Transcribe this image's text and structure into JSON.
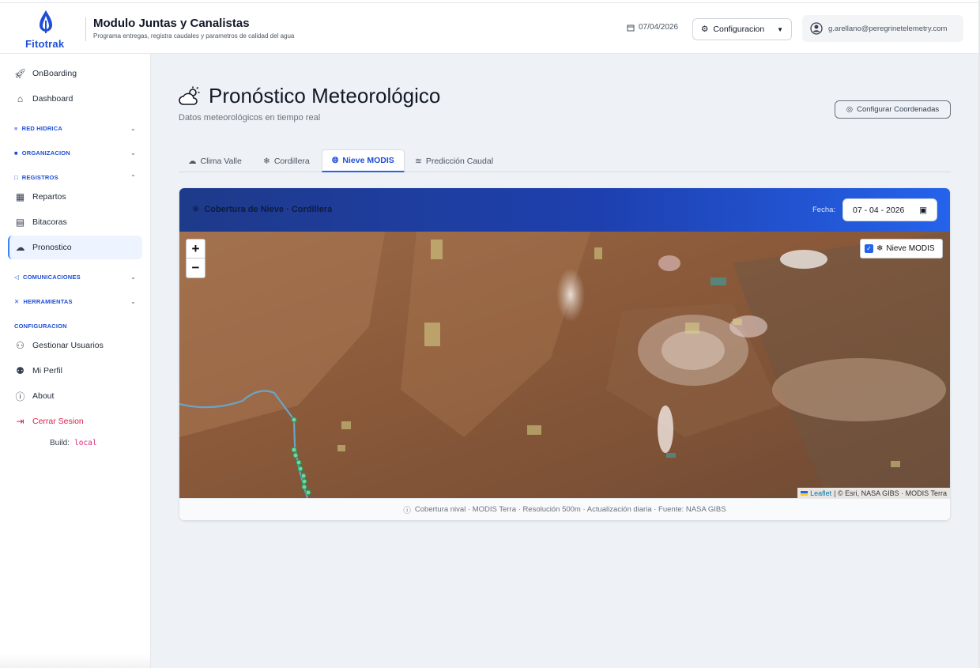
{
  "header": {
    "logo_text": "Fitotrak",
    "title": "Modulo Juntas y Canalistas",
    "subtitle": "Programa entregas, registra caudales y parametros de calidad del agua",
    "date": "07/04/2026",
    "config_label": "Configuracion",
    "user_email": "g.arellano@peregrinetelemetry.com"
  },
  "sidebar": {
    "onboarding": "OnBoarding",
    "dashboard": "Dashboard",
    "sec_red": "RED HIDRICA",
    "sec_org": "ORGANIZACION",
    "sec_reg": "REGISTROS",
    "repartos": "Repartos",
    "bitacoras": "Bitacoras",
    "pronostico": "Pronostico",
    "sec_com": "COMUNICACIONES",
    "sec_her": "HERRAMIENTAS",
    "sec_cfg": "CONFIGURACION",
    "usuarios": "Gestionar Usuarios",
    "perfil": "Mi Perfil",
    "about": "About",
    "logout": "Cerrar Sesion",
    "build_label": "Build:",
    "build_value": "local"
  },
  "page": {
    "title": "Pronóstico Meteorológico",
    "subtitle": "Datos meteorológicos en tiempo real",
    "coord_button": "Configurar Coordenadas"
  },
  "tabs": [
    "Clima Valle",
    "Cordillera",
    "Nieve MODIS",
    "Predicción Caudal"
  ],
  "active_tab": "Nieve MODIS",
  "card": {
    "title": "Cobertura de Nieve · Cordillera",
    "fecha_label": "Fecha:",
    "fecha_value": "07 - 04 - 2026",
    "layer_label": "Nieve MODIS",
    "layer_checked": true,
    "zoom_in": "+",
    "zoom_out": "−",
    "attribution_link": "Leaflet",
    "attribution_text": "| © Esri, NASA GIBS · MODIS Terra",
    "footer": "Cobertura nival · MODIS Terra · Resolución 500m · Actualización diaria · Fuente: NASA GIBS"
  },
  "colors": {
    "accent": "#2563eb",
    "sidebar_section": "#1d4ed8",
    "logout": "#e11d48",
    "header_gradient_start": "#1e3a8a",
    "header_gradient_end": "#2563eb"
  }
}
